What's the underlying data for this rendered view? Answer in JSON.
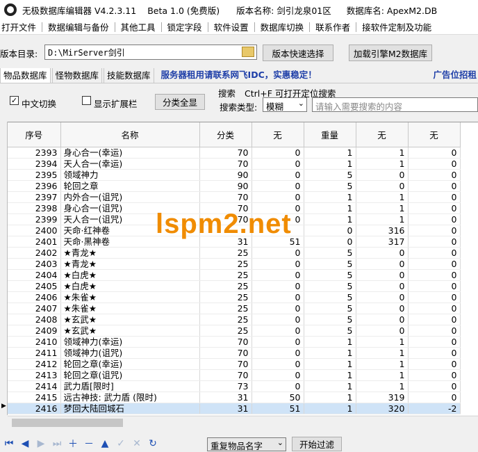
{
  "titlebar": {
    "app_name": "无极数据库编辑器 V4.2.3.11",
    "edition": "Beta 1.0 (免费版)",
    "version_name": "版本名称: 剑引龙泉01区",
    "db_name": "数据库名: ApexM2.DB"
  },
  "menu": [
    "打开文件",
    "数据编辑与备份",
    "其他工具",
    "锁定字段",
    "软件设置",
    "数据库切换",
    "联系作者",
    "接软件定制及功能"
  ],
  "dir": {
    "label": "版本目录:",
    "value": "D:\\MirServer剑引",
    "quick_select": "版本快速选择",
    "load_engine": "加载引擎M2数据库"
  },
  "tabs": [
    "物品数据库",
    "怪物数据库",
    "技能数据库"
  ],
  "banner": "服务器租用请联系网飞IDC，实惠稳定！",
  "ad": "广告位招租",
  "toolbar": {
    "chk_chinese": "中文切换",
    "chk_chinese_checked": true,
    "chk_ext": "显示扩展栏",
    "expand_all": "分类全显",
    "search_label": "搜索",
    "search_hint": "Ctrl+F 可打开定位搜索",
    "search_type_label": "搜索类型:",
    "search_type_value": "模糊",
    "search_placeholder": "请输入需要搜索的内容"
  },
  "table": {
    "headers": [
      "序号",
      "名称",
      "分类",
      "无",
      "重量",
      "无",
      "无"
    ],
    "rows": [
      [
        "2393",
        "身心合一(幸运)",
        "70",
        "0",
        "1",
        "1",
        "0"
      ],
      [
        "2394",
        "天人合一(幸运)",
        "70",
        "0",
        "1",
        "1",
        "0"
      ],
      [
        "2395",
        "领域神力",
        "90",
        "0",
        "5",
        "0",
        "0"
      ],
      [
        "2396",
        "轮回之章",
        "90",
        "0",
        "5",
        "0",
        "0"
      ],
      [
        "2397",
        "内外合一(诅咒)",
        "70",
        "0",
        "1",
        "1",
        "0"
      ],
      [
        "2398",
        "身心合一(诅咒)",
        "70",
        "0",
        "1",
        "1",
        "0"
      ],
      [
        "2399",
        "天人合一(诅咒)",
        "70",
        "0",
        "1",
        "1",
        "0"
      ],
      [
        "2400",
        "天命·红神卷",
        "",
        "",
        "0",
        "316",
        "0"
      ],
      [
        "2401",
        "天命·黑神卷",
        "31",
        "51",
        "0",
        "317",
        "0"
      ],
      [
        "2402",
        "★青龙★",
        "25",
        "0",
        "5",
        "0",
        "0"
      ],
      [
        "2403",
        "★青龙★",
        "25",
        "0",
        "5",
        "0",
        "0"
      ],
      [
        "2404",
        "★白虎★",
        "25",
        "0",
        "5",
        "0",
        "0"
      ],
      [
        "2405",
        "★白虎★",
        "25",
        "0",
        "5",
        "0",
        "0"
      ],
      [
        "2406",
        "★朱雀★",
        "25",
        "0",
        "5",
        "0",
        "0"
      ],
      [
        "2407",
        "★朱雀★",
        "25",
        "0",
        "5",
        "0",
        "0"
      ],
      [
        "2408",
        "★玄武★",
        "25",
        "0",
        "5",
        "0",
        "0"
      ],
      [
        "2409",
        "★玄武★",
        "25",
        "0",
        "5",
        "0",
        "0"
      ],
      [
        "2410",
        "领域神力(幸运)",
        "70",
        "0",
        "1",
        "1",
        "0"
      ],
      [
        "2411",
        "领域神力(诅咒)",
        "70",
        "0",
        "1",
        "1",
        "0"
      ],
      [
        "2412",
        "轮回之章(幸运)",
        "70",
        "0",
        "1",
        "1",
        "0"
      ],
      [
        "2413",
        "轮回之章(诅咒)",
        "70",
        "0",
        "1",
        "1",
        "0"
      ],
      [
        "2414",
        "武力盾[限时]",
        "73",
        "0",
        "1",
        "1",
        "0"
      ],
      [
        "2415",
        "远古神技: 武力盾 (限时)",
        "31",
        "50",
        "1",
        "319",
        "0"
      ],
      [
        "2416",
        "梦回大陆回城石",
        "31",
        "51",
        "1",
        "320",
        "-2"
      ]
    ],
    "selected_index": 23
  },
  "watermark": "lspm2.net",
  "bottom": {
    "dup_select": "重复物品名字",
    "filter_button": "开始过滤"
  },
  "nav_icons": [
    "first-icon",
    "prior-icon",
    "next-icon",
    "last-icon",
    "insert-icon",
    "delete-icon",
    "edit-icon",
    "post-icon",
    "cancel-icon",
    "refresh-icon"
  ]
}
